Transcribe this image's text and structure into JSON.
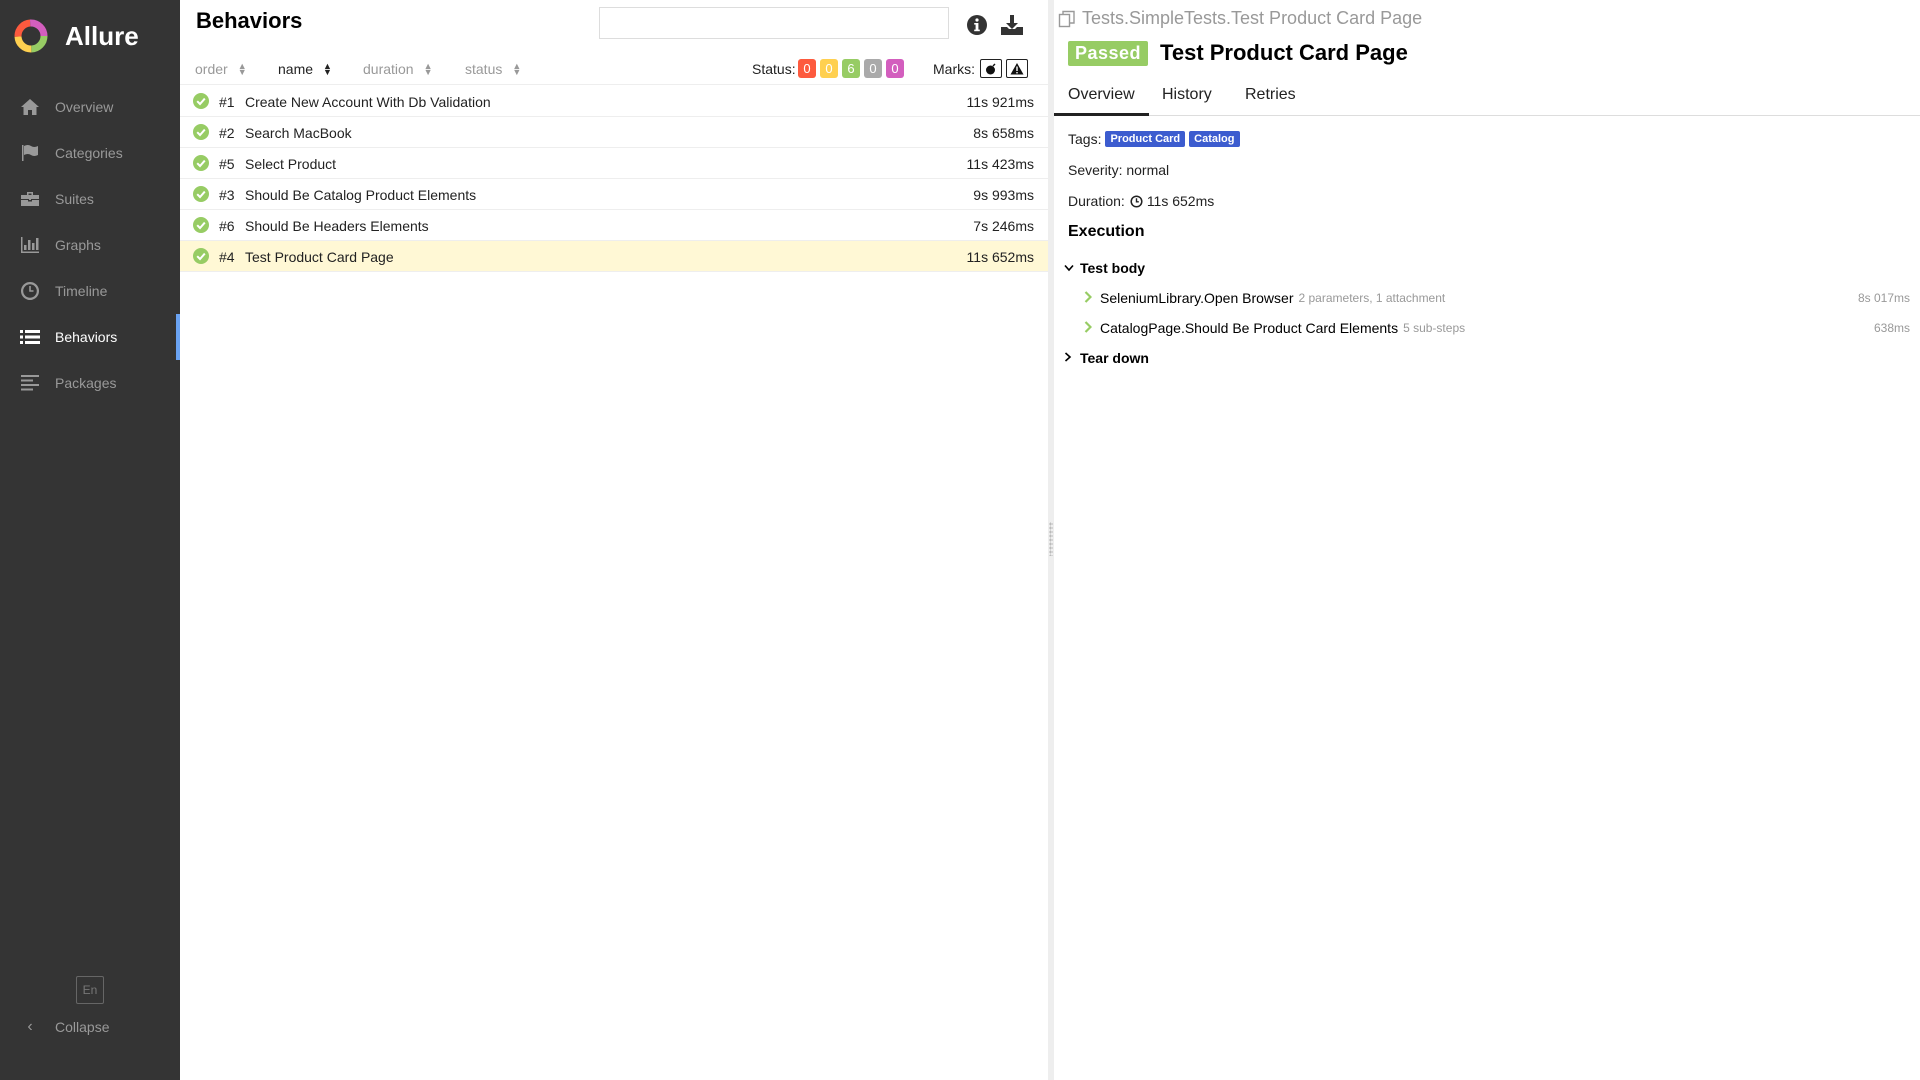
{
  "brand": {
    "name": "Allure"
  },
  "sidebar": {
    "items": [
      {
        "label": "Overview",
        "icon": "home-icon"
      },
      {
        "label": "Categories",
        "icon": "flag-icon"
      },
      {
        "label": "Suites",
        "icon": "briefcase-icon"
      },
      {
        "label": "Graphs",
        "icon": "bar-chart-icon"
      },
      {
        "label": "Timeline",
        "icon": "clock-icon"
      },
      {
        "label": "Behaviors",
        "icon": "list-icon",
        "active": true
      },
      {
        "label": "Packages",
        "icon": "align-left-icon"
      }
    ],
    "lang": "En",
    "collapse_label": "Collapse"
  },
  "behaviors": {
    "title": "Behaviors",
    "search": {
      "value": "",
      "placeholder": ""
    },
    "sort": {
      "order": "order",
      "name": "name",
      "duration": "duration",
      "status": "status",
      "active": "name"
    },
    "status_label": "Status:",
    "status_counts": [
      {
        "value": "0",
        "color": "#fd5a3e",
        "status": "failed"
      },
      {
        "value": "0",
        "color": "#ffd050",
        "status": "broken"
      },
      {
        "value": "6",
        "color": "#97cc64",
        "status": "passed"
      },
      {
        "value": "0",
        "color": "#aaaaaa",
        "status": "skipped"
      },
      {
        "value": "0",
        "color": "#d35ebe",
        "status": "unknown"
      }
    ],
    "marks_label": "Marks:",
    "rows": [
      {
        "num": "#1",
        "name": "Create New Account With Db Validation",
        "duration": "11s 921ms"
      },
      {
        "num": "#2",
        "name": "Search MacBook",
        "duration": "8s 658ms"
      },
      {
        "num": "#5",
        "name": "Select Product",
        "duration": "11s 423ms"
      },
      {
        "num": "#3",
        "name": "Should Be Catalog Product Elements",
        "duration": "9s 993ms"
      },
      {
        "num": "#6",
        "name": "Should Be Headers Elements",
        "duration": "7s 246ms"
      },
      {
        "num": "#4",
        "name": "Test Product Card Page",
        "duration": "11s 652ms",
        "selected": true
      }
    ]
  },
  "detail": {
    "breadcrumb": "Tests.SimpleTests.Test Product Card Page",
    "status": "Passed",
    "status_color": "#97cc64",
    "title": "Test Product Card Page",
    "tabs": [
      "Overview",
      "History",
      "Retries"
    ],
    "tags_label": "Tags:",
    "tags": [
      "Product Card",
      "Catalog"
    ],
    "tag_color": "#3c5ccf",
    "severity_label": "Severity: normal",
    "duration_label": "Duration:",
    "duration": "11s 652ms",
    "execution_title": "Execution",
    "test_body_label": "Test body",
    "steps": [
      {
        "name": "SeleniumLibrary.Open Browser",
        "meta": "2 parameters, 1 attachment",
        "duration": "8s 017ms"
      },
      {
        "name": "CatalogPage.Should Be Product Card Elements",
        "meta": "5 sub-steps",
        "duration": "638ms"
      }
    ],
    "tear_down_label": "Tear down"
  }
}
